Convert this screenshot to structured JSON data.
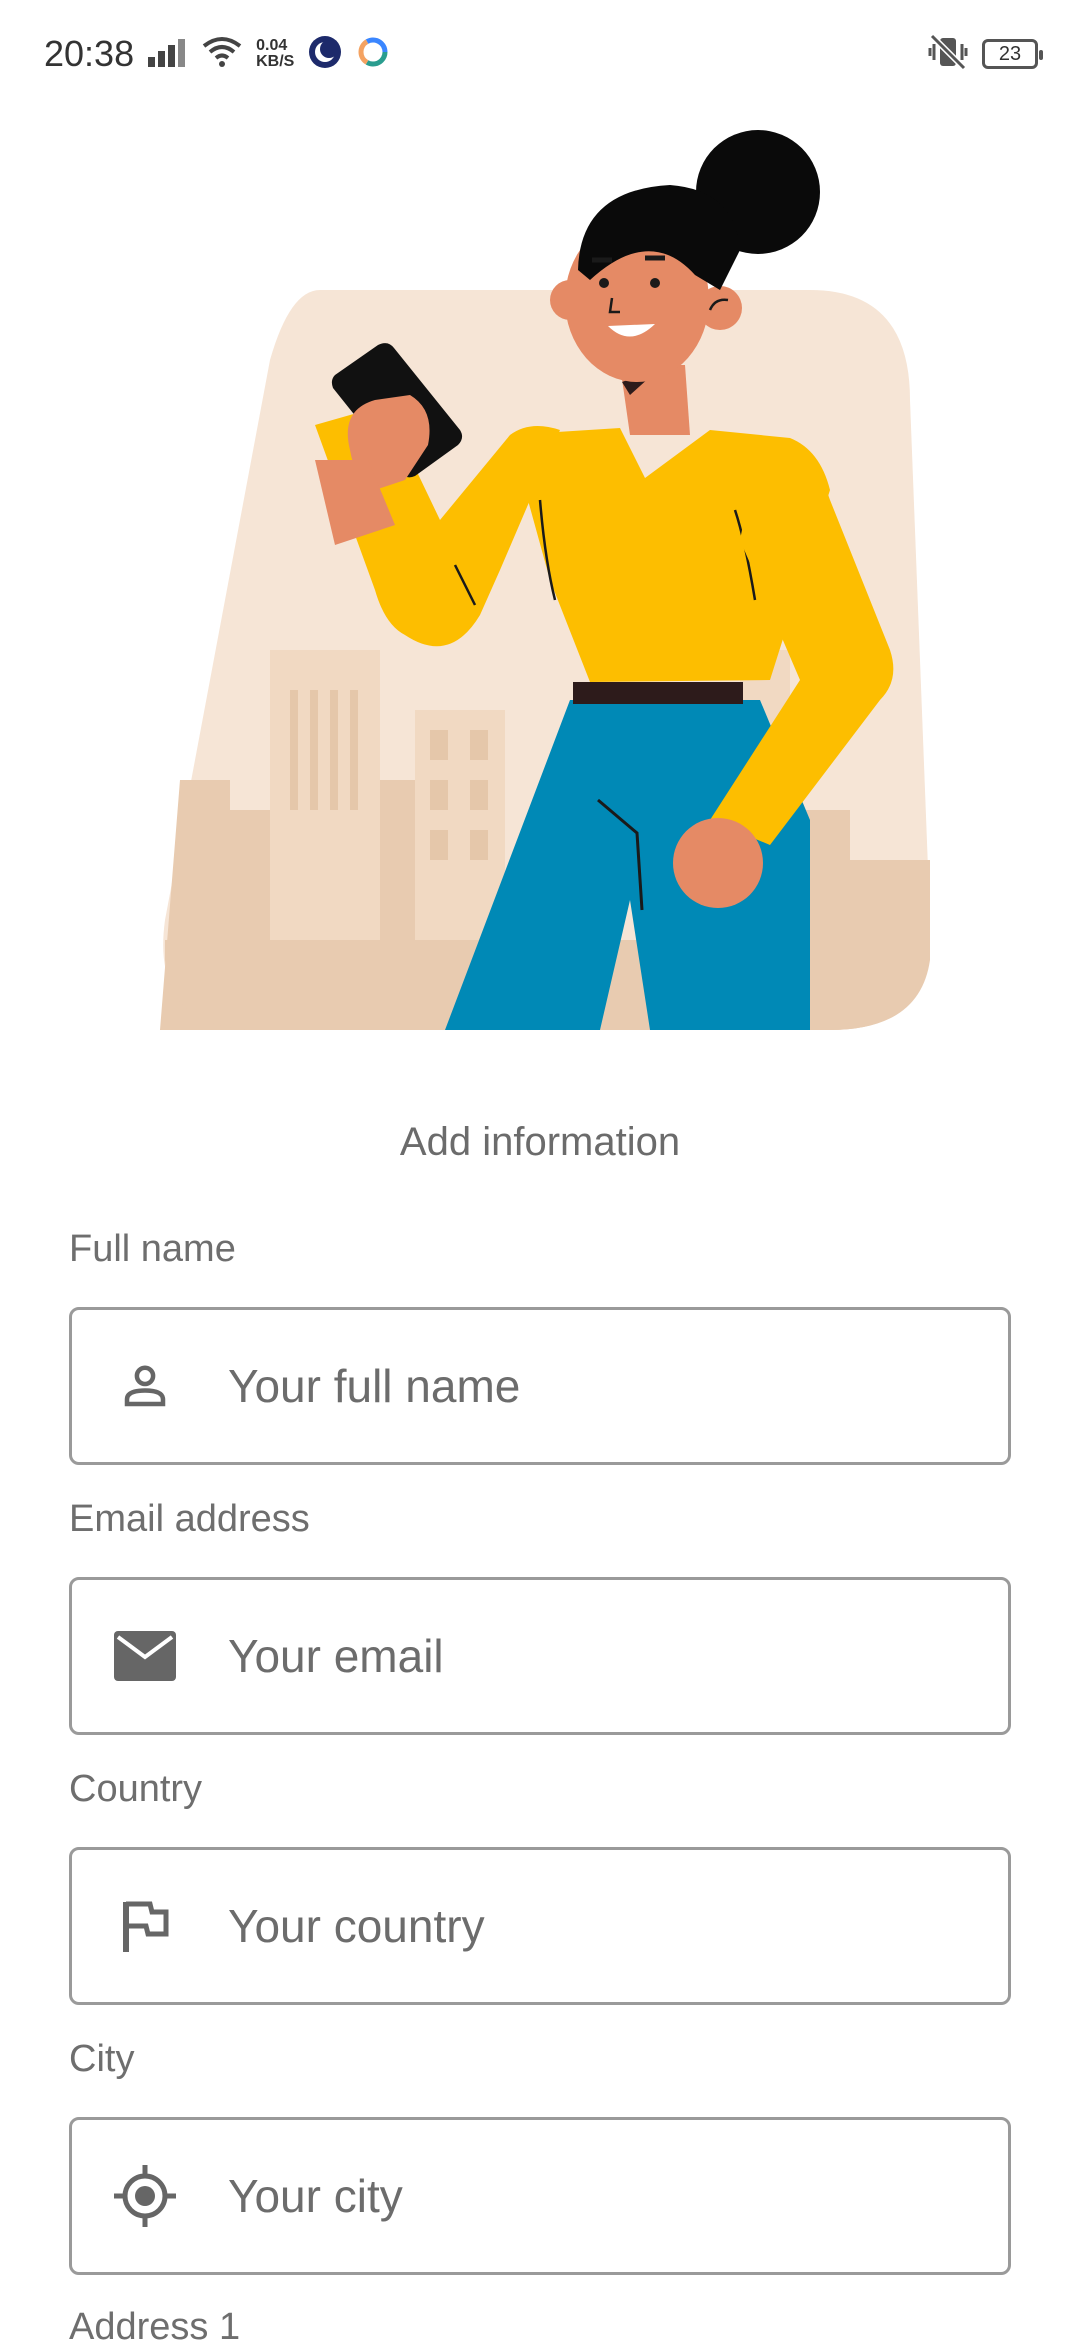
{
  "status_bar": {
    "time": "20:38",
    "net_speed_value": "0.04",
    "net_speed_unit": "KB/S",
    "battery": "23"
  },
  "form": {
    "title": "Add information",
    "fields": [
      {
        "label": "Full name",
        "placeholder": "Your full name",
        "icon": "person-icon"
      },
      {
        "label": "Email address",
        "placeholder": "Your email",
        "icon": "mail-icon"
      },
      {
        "label": "Country",
        "placeholder": "Your country",
        "icon": "flag-icon"
      },
      {
        "label": "City",
        "placeholder": "Your city",
        "icon": "location-target-icon"
      }
    ],
    "next_label": "Address 1"
  },
  "colors": {
    "accent_yellow": "#FDBE00",
    "pants_blue": "#0089B6",
    "skin": "#E58A65",
    "backdrop": "#F6E5D6"
  }
}
